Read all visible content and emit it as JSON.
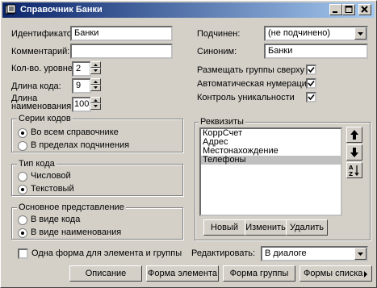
{
  "window": {
    "title": "Справочник Банки",
    "title_bg": "#0a246a"
  },
  "fields": {
    "identifier_label": "Идентификатор:",
    "identifier_value": "Банки",
    "comment_label": "Комментарий:",
    "comment_value": "",
    "subordinate_label": "Подчинен:",
    "subordinate_value": "(не подчинено)",
    "synonym_label": "Синоним:",
    "synonym_value": "Банки",
    "levels_label": "Кол-во. уровней:",
    "levels_value": "2",
    "code_len_label": "Длина кода:",
    "code_len_value": "9",
    "name_len_label_1": "Длина",
    "name_len_label_2": "наименования:",
    "name_len_value": "100"
  },
  "checkboxes": [
    {
      "label": "Размещать группы сверху",
      "checked": true
    },
    {
      "label": "Автоматическая нумерация",
      "checked": true
    },
    {
      "label": "Контроль уникальности",
      "checked": true
    }
  ],
  "series_group": {
    "title": "Серии кодов",
    "options": [
      "Во всем справочнике",
      "В пределах подчинения"
    ],
    "selected": 0
  },
  "code_type_group": {
    "title": "Тип кода",
    "options": [
      "Числовой",
      "Текстовый"
    ],
    "selected": 1
  },
  "main_repr_group": {
    "title": "Основное представление",
    "options": [
      "В виде кода",
      "В виде наименования"
    ],
    "selected": 1
  },
  "requisites": {
    "title": "Реквизиты",
    "items": [
      "КоррСчет",
      "Адрес",
      "Местонахождение",
      "Телефоны"
    ],
    "selected": 3,
    "buttons": {
      "new": "Новый",
      "edit": "Изменить",
      "delete": "Удалить"
    }
  },
  "one_form": {
    "label": "Одна форма для элемента и группы",
    "checked": false
  },
  "edit_mode": {
    "label": "Редактировать:",
    "value": "В диалоге"
  },
  "bottom_buttons": [
    "Описание",
    "Форма элемента",
    "Форма группы",
    "Формы списка"
  ],
  "icons": {
    "move_up": "arrow-up-icon",
    "move_down": "arrow-down-icon",
    "sort": "sort-az-icon"
  }
}
